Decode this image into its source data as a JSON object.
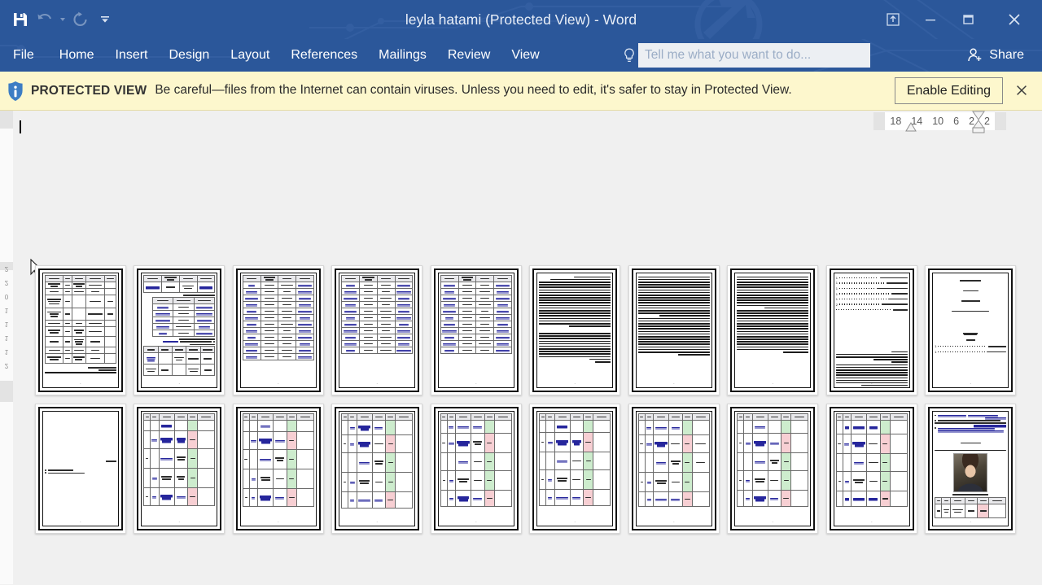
{
  "app": {
    "window_title": "leyla hatami (Protected View) - Word",
    "accent_color": "#2b579a"
  },
  "quick_access": {
    "items": [
      {
        "name": "save-icon",
        "label": "Save",
        "enabled": true
      },
      {
        "name": "undo-icon",
        "label": "Undo",
        "enabled": false
      },
      {
        "name": "redo-icon",
        "label": "Repeat",
        "enabled": false
      },
      {
        "name": "customize-quick-access-icon",
        "label": "Customize Quick Access Toolbar",
        "enabled": true
      }
    ]
  },
  "window_controls": [
    {
      "name": "ribbon-display-options-icon",
      "label": "Ribbon Display Options"
    },
    {
      "name": "minimize-icon",
      "label": "Minimize"
    },
    {
      "name": "restore-icon",
      "label": "Restore Down"
    },
    {
      "name": "close-icon",
      "label": "Close"
    }
  ],
  "ribbon": {
    "tabs": [
      {
        "label": "File"
      },
      {
        "label": "Home"
      },
      {
        "label": "Insert"
      },
      {
        "label": "Design"
      },
      {
        "label": "Layout"
      },
      {
        "label": "References"
      },
      {
        "label": "Mailings"
      },
      {
        "label": "Review"
      },
      {
        "label": "View"
      }
    ],
    "tell_me": {
      "icon": "lightbulb-icon",
      "placeholder": "Tell me what you want to do...",
      "value": ""
    },
    "share": {
      "icon": "share-person-icon",
      "label": "Share"
    }
  },
  "protected_view": {
    "icon": "info-shield-icon",
    "label": "PROTECTED VIEW",
    "message": "Be careful—files from the Internet can contain viruses. Unless you need to edit, it's safer to stay in Protected View.",
    "enable_button": "Enable Editing",
    "close_icon": "close-icon",
    "background_color": "#fdf7cd"
  },
  "ruler": {
    "horizontal_ticks": [
      "18",
      "14",
      "10",
      "6",
      "2",
      "2"
    ],
    "vertical_ticks": [
      "2",
      "2",
      "0",
      "1",
      "1",
      "1",
      "1",
      "2",
      "2"
    ]
  },
  "document": {
    "cursor": "text-select-arrow-cursor",
    "zoom_view": "multiple-pages",
    "page_count": 20,
    "rows": [
      {
        "pages": [
          {
            "n": 1,
            "type": "table-page",
            "page_label": "-"
          },
          {
            "n": 2,
            "type": "table-links-page",
            "page_label": "-"
          },
          {
            "n": 3,
            "type": "table-links-page",
            "page_label": "-"
          },
          {
            "n": 4,
            "type": "table-links-page",
            "page_label": "-"
          },
          {
            "n": 5,
            "type": "table-links-page",
            "page_label": "-"
          },
          {
            "n": 6,
            "type": "text-page",
            "page_label": "-"
          },
          {
            "n": 7,
            "type": "text-page",
            "page_label": "-"
          },
          {
            "n": 8,
            "type": "text-page",
            "page_label": "-"
          },
          {
            "n": 9,
            "type": "toc-page",
            "page_label": "-"
          },
          {
            "n": 10,
            "type": "cover-page",
            "page_label": "-"
          }
        ]
      },
      {
        "pages": [
          {
            "n": 11,
            "type": "sparse-links-page",
            "page_label": "-"
          },
          {
            "n": 12,
            "type": "colored-table-page",
            "page_label": "-"
          },
          {
            "n": 13,
            "type": "colored-table-page",
            "page_label": "-"
          },
          {
            "n": 14,
            "type": "colored-table-page",
            "page_label": "-"
          },
          {
            "n": 15,
            "type": "colored-table-page",
            "page_label": "-"
          },
          {
            "n": 16,
            "type": "colored-table-page",
            "page_label": "-"
          },
          {
            "n": 17,
            "type": "colored-table-page",
            "page_label": "-"
          },
          {
            "n": 18,
            "type": "colored-table-page",
            "page_label": "-"
          },
          {
            "n": 19,
            "type": "colored-table-page",
            "page_label": "-"
          },
          {
            "n": 20,
            "type": "photo-page",
            "page_label": "-"
          }
        ]
      }
    ]
  }
}
